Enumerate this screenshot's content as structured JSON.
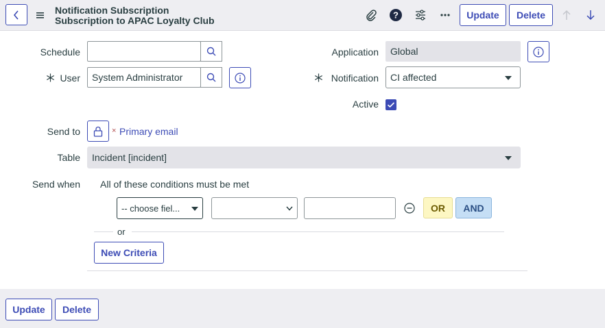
{
  "header": {
    "title_line1": "Notification Subscription",
    "title_line2": "Subscription to APAC Loyalty Club",
    "update_label": "Update",
    "delete_label": "Delete"
  },
  "form": {
    "schedule_label": "Schedule",
    "schedule_value": "",
    "user_label": "User",
    "user_value": "System Administrator",
    "application_label": "Application",
    "application_value": "Global",
    "notification_label": "Notification",
    "notification_value": "CI affected",
    "active_label": "Active",
    "active_checked": true,
    "sendto_label": "Send to",
    "sendto_remove": "×",
    "sendto_value": "Primary email",
    "table_label": "Table",
    "table_value": "Incident [incident]",
    "sendwhen_label": "Send when",
    "conditions_heading": "All of these conditions must be met",
    "choose_field": "-- choose fiel...",
    "operator_value": "",
    "condition_value": "",
    "or_label": "OR",
    "and_label": "AND",
    "or_divider": "or",
    "new_criteria_label": "New Criteria"
  },
  "footer": {
    "update_label": "Update",
    "delete_label": "Delete"
  },
  "colors": {
    "accent": "#3c4bb5",
    "or_bg": "#fdf7c3",
    "and_bg": "#c5def5"
  }
}
